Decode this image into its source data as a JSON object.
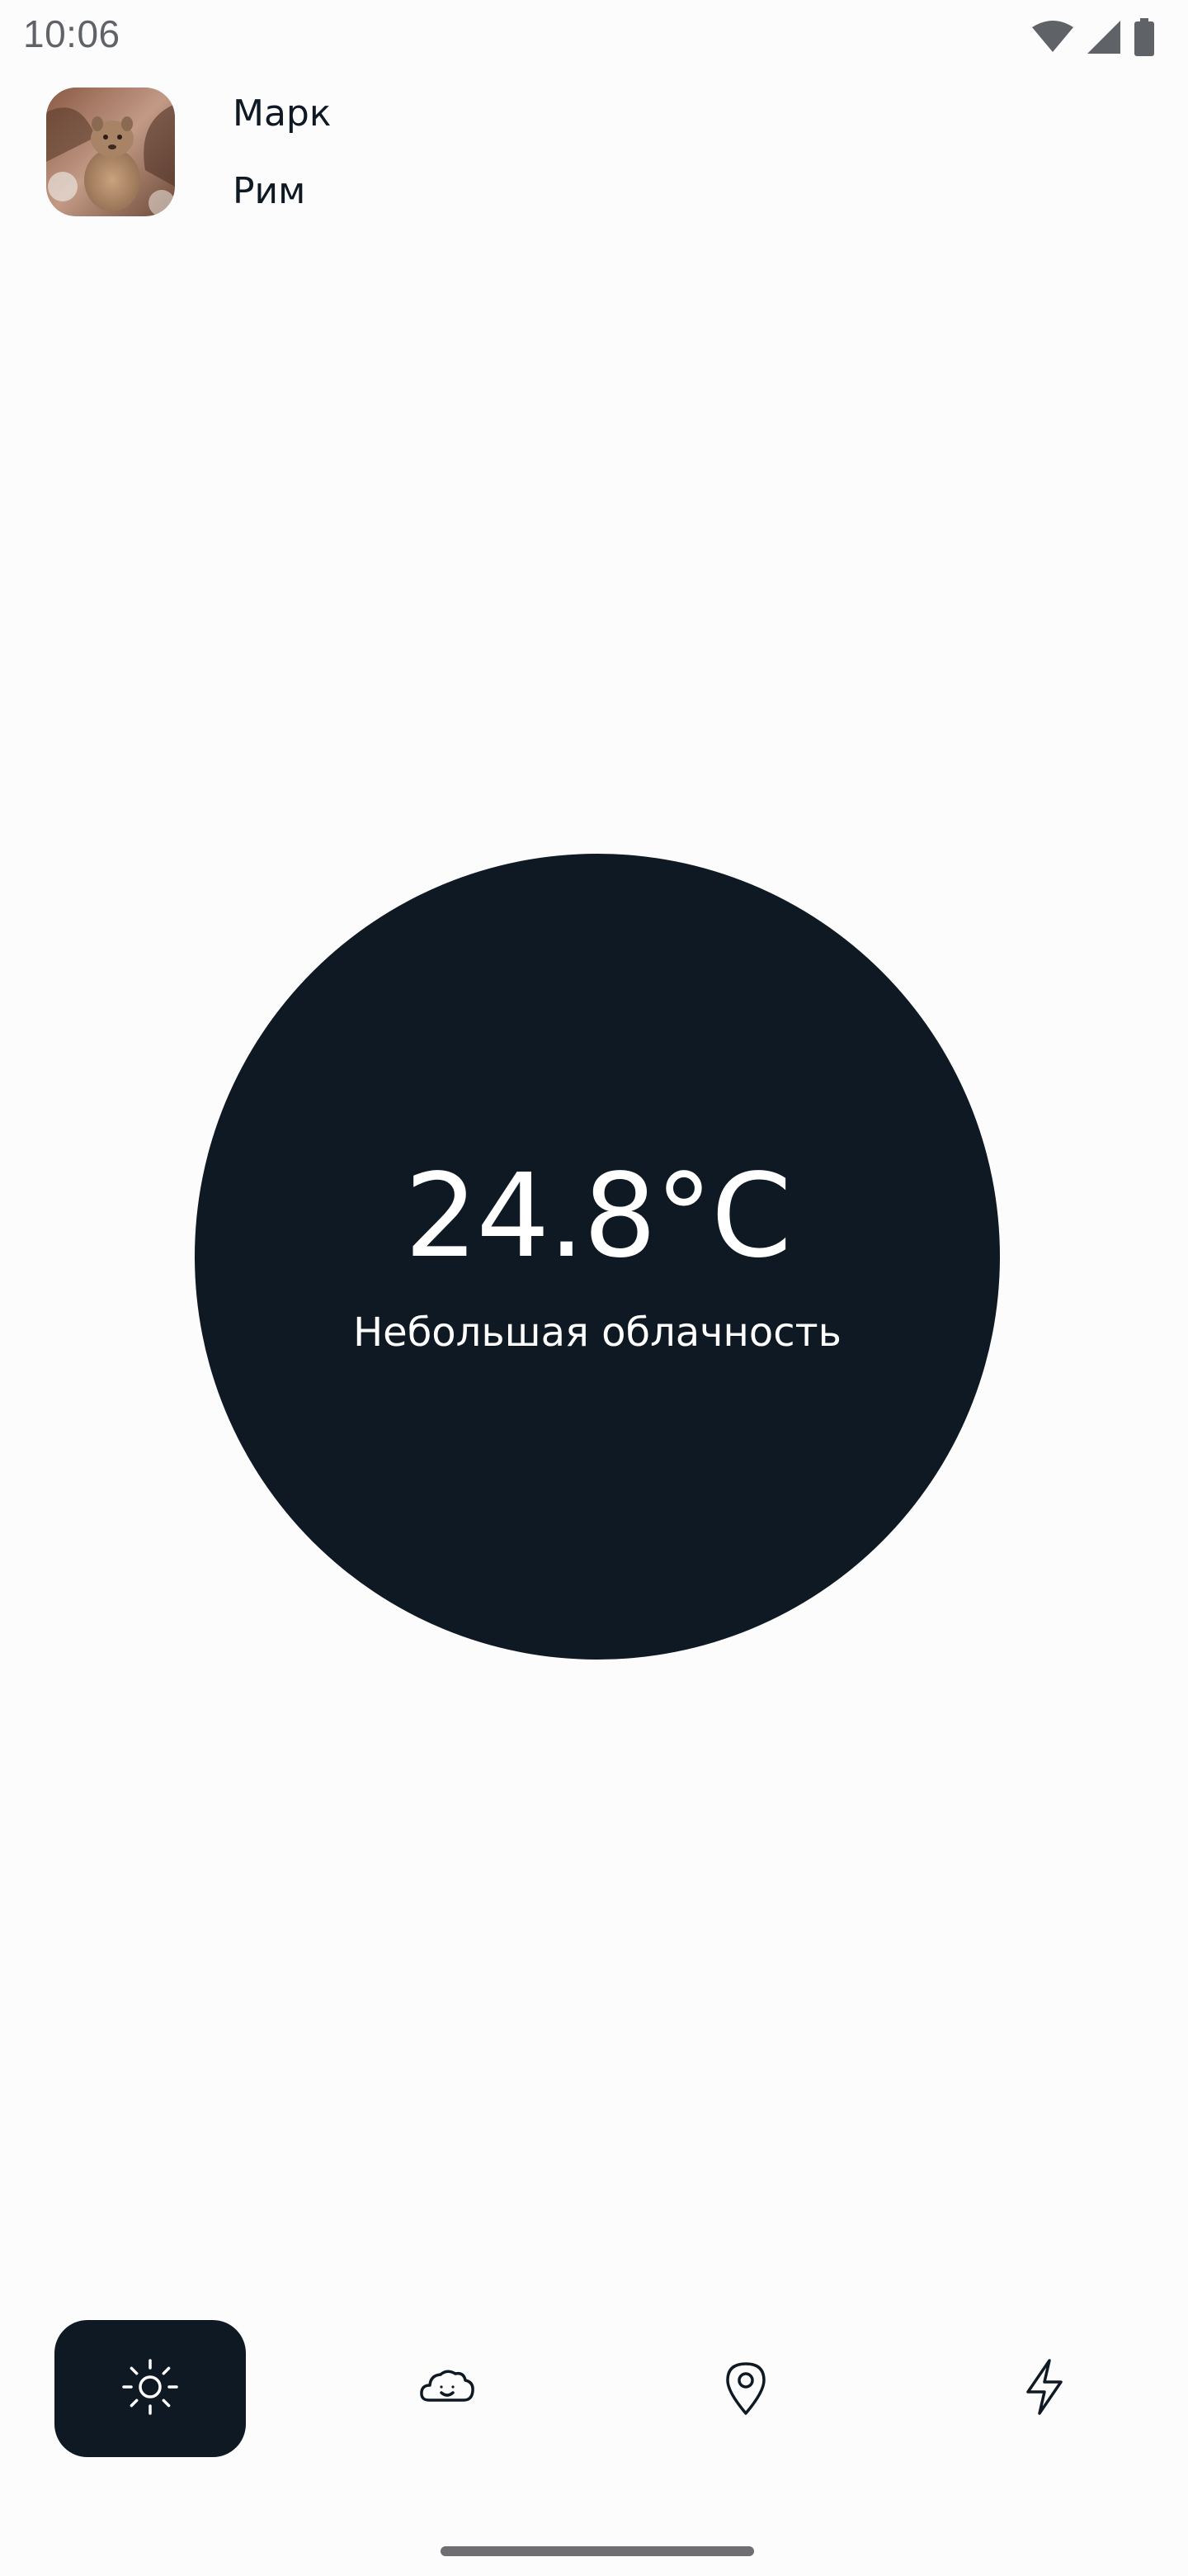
{
  "status_bar": {
    "time": "10:06",
    "icons": [
      "wifi-icon",
      "cellular-signal-icon",
      "battery-icon"
    ]
  },
  "profile": {
    "name": "Марк",
    "city": "Рим",
    "avatar": "user-avatar-photo"
  },
  "weather": {
    "temperature": "24.8°C",
    "condition": "Небольшая облачность"
  },
  "bottom_nav": {
    "items": [
      {
        "id": "weather",
        "icon": "sun-icon",
        "active": true
      },
      {
        "id": "forecast",
        "icon": "cloud-smile-icon",
        "active": false
      },
      {
        "id": "location",
        "icon": "map-pin-icon",
        "active": false
      },
      {
        "id": "energy",
        "icon": "lightning-icon",
        "active": false
      }
    ]
  },
  "colors": {
    "background": "#fdfcfd",
    "primary_dark": "#0f1923",
    "on_dark": "#ffffff",
    "status_text": "#5f6368"
  }
}
